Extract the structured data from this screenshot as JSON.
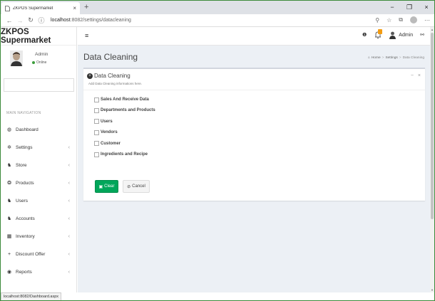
{
  "browser": {
    "tab_title": "ZKPOS Supermarket",
    "tab_close": "×",
    "new_tab": "+",
    "url_host": "localhost",
    "url_path": ":8082/settings/datacleaning",
    "status_url": "localhost:8082/Dashboard.aspx",
    "window_controls": {
      "minimize": "−",
      "restore": "❐",
      "close": "×"
    }
  },
  "sidebar": {
    "brand": "ZKPOS Supermarket",
    "user_name": "Admin",
    "user_status": "Online",
    "nav_header": "MAIN NAVIGATION",
    "items": [
      {
        "label": "Dashboard",
        "icon": "dashboard-icon",
        "glyph": "◍",
        "has_chevron": false
      },
      {
        "label": "Settings",
        "icon": "gear-icon",
        "glyph": "✲",
        "has_chevron": true
      },
      {
        "label": "Store",
        "icon": "users-icon",
        "glyph": "♞",
        "has_chevron": true
      },
      {
        "label": "Products",
        "icon": "products-icon",
        "glyph": "❂",
        "has_chevron": true
      },
      {
        "label": "Users",
        "icon": "users-icon",
        "glyph": "♞",
        "has_chevron": true
      },
      {
        "label": "Accounts",
        "icon": "users-icon",
        "glyph": "♞",
        "has_chevron": true
      },
      {
        "label": "Inventory",
        "icon": "inventory-icon",
        "glyph": "▦",
        "has_chevron": true
      },
      {
        "label": "Discount Offer",
        "icon": "plus-icon",
        "glyph": "+",
        "has_chevron": true
      },
      {
        "label": "Reports",
        "icon": "reports-icon",
        "glyph": "◉",
        "has_chevron": true
      }
    ],
    "chevron": "‹"
  },
  "topbar": {
    "menu_glyph": "≡",
    "info_glyph": "❶",
    "admin_label": "Admin",
    "share_glyph": "⚯"
  },
  "content": {
    "page_title": "Data Cleaning",
    "breadcrumb": [
      "Home",
      "Settings",
      "Data Cleaning"
    ],
    "breadcrumb_sep": ">",
    "box": {
      "title": "Data Cleaning",
      "subtitle": "Add Data Cleaning informations here.",
      "collapse": "−",
      "close": "×",
      "checkboxes": [
        "Sales And Receive Data",
        "Departments and Products",
        "Users",
        "Vendors",
        "Customer",
        "Ingredients and Recipe"
      ],
      "clear_label": "Clear",
      "cancel_label": "Cancel"
    }
  },
  "colors": {
    "clear_button": "#00a65a",
    "online_dot": "#3c9d3c",
    "notification_badge": "#f39c12",
    "content_bg": "#ecf0f5"
  }
}
